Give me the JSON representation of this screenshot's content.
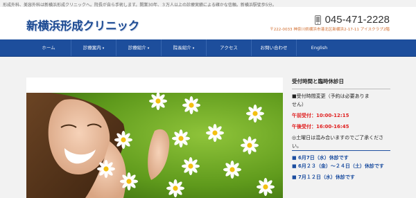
{
  "site": {
    "tagline": "形成外科、美容外科は新横浜形成クリニックへ。院長が自ら手術します。開業30年、３万人以上の診療実績による確かな信頼。新横浜駅徒歩5分。",
    "logo_text": "新横浜形成クリニック",
    "phone": "045-471-2228",
    "address": "〒222-0033 神奈川県横浜市港北区新横浜2-17-11 アイスクラブ2階"
  },
  "nav": {
    "items": [
      {
        "label": "ホーム",
        "dropdown": false
      },
      {
        "label": "診療案内",
        "dropdown": true
      },
      {
        "label": "診療紹介",
        "dropdown": true
      },
      {
        "label": "院長紹介",
        "dropdown": true
      },
      {
        "label": "アクセス",
        "dropdown": false
      },
      {
        "label": "お問い合わせ",
        "dropdown": false
      },
      {
        "label": "English",
        "dropdown": false
      }
    ],
    "chevron": "▾"
  },
  "sidebar": {
    "title": "受付時間と臨時休診日",
    "line1": "■受付時間変更（予約は必要ありま",
    "line2": "せん）",
    "am": "午前受付：10:00-12:15",
    "pm": "午後受付：16:00-16:45",
    "note": "◎土曜日は混み合いますのでご了承ください。",
    "closures": [
      "■ 6月7日（水）休診です",
      "■ 6月２３（金）～２４日（土）休診です",
      "■ 7月１２日（水）休診です"
    ]
  },
  "colors": {
    "nav_bg": "#1d4e9c",
    "logo": "#1c4a92",
    "address": "#d06a2a",
    "hours_red": "#e02020",
    "closure_blue": "#1c4ea0"
  },
  "icons": {
    "phone": "phone-icon",
    "hero": "woman-daisies-photo"
  }
}
